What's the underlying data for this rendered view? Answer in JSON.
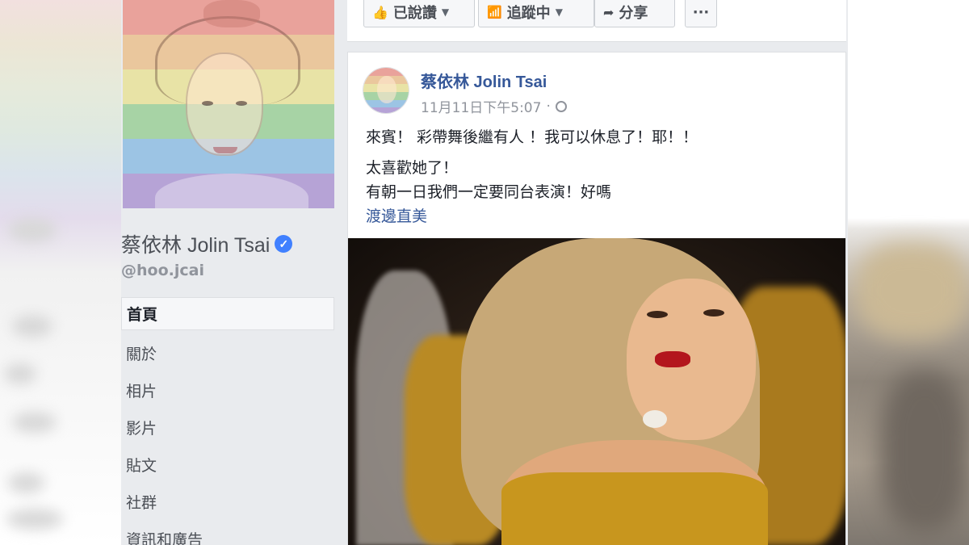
{
  "page": {
    "name": "蔡依林 Jolin Tsai",
    "handle": "@hoo.jcai",
    "verified": true
  },
  "nav": {
    "items": [
      {
        "label": "首頁",
        "active": true
      },
      {
        "label": "關於",
        "active": false
      },
      {
        "label": "相片",
        "active": false
      },
      {
        "label": "影片",
        "active": false
      },
      {
        "label": "貼文",
        "active": false
      },
      {
        "label": "社群",
        "active": false
      },
      {
        "label": "資訊和廣告",
        "active": false
      }
    ]
  },
  "actions": {
    "like_label": "已說讚",
    "follow_label": "追蹤中",
    "share_label": "分享",
    "more_label": "···"
  },
  "post": {
    "author": "蔡依林 Jolin Tsai",
    "timestamp": "11月11日下午5:07",
    "separator": "·",
    "lines": [
      "來賓！ 彩帶舞後繼有人 ！我可以休息了！耶！！",
      "太喜歡她了！",
      "有朝一日我們一定要同台表演！好嗎"
    ],
    "tag": "渡邊直美"
  },
  "colors": {
    "link": "#365899",
    "rainbow": [
      "#e57373",
      "#ffb74d",
      "#fff176",
      "#81c784",
      "#64b5f6",
      "#ba68c8"
    ]
  },
  "icons": {
    "like": "thumbs-up-icon",
    "follow": "rss-icon",
    "share": "share-arrow-icon",
    "privacy": "globe-icon",
    "verified": "verified-badge-icon"
  }
}
